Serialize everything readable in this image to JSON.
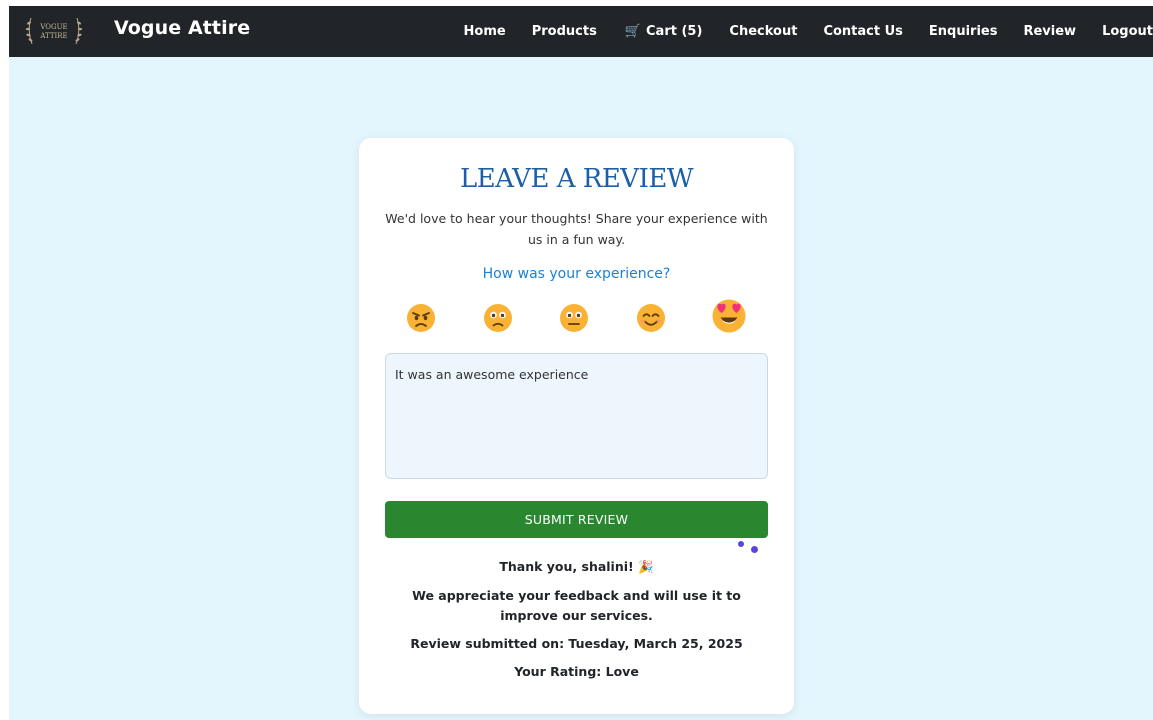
{
  "brand": {
    "logo_text_top": "VOGUE",
    "logo_text_bottom": "ATTIRE",
    "name": "Vogue Attire"
  },
  "nav": {
    "home": "Home",
    "products": "Products",
    "cart": "Cart (5)",
    "checkout": "Checkout",
    "contact": "Contact Us",
    "enquiries": "Enquiries",
    "review": "Review",
    "logout": "Logout"
  },
  "review": {
    "title": "LEAVE A REVIEW",
    "subtitle": "We'd love to hear your thoughts! Share your experience with us in a fun way.",
    "question": "How was your experience?",
    "emojis": [
      "angry-face",
      "sad-face",
      "neutral-face",
      "happy-face",
      "love-face"
    ],
    "selected_emoji": "love-face",
    "comment": "It was an awesome experience",
    "submit_label": "SUBMIT REVIEW",
    "thanks": "Thank you, shalini! 🎉",
    "appreciate": "We appreciate your feedback and will use it to improve our services.",
    "submitted_on": "Review submitted on: Tuesday, March 25, 2025",
    "rating": "Your Rating: Love"
  },
  "colors": {
    "navbar": "#212529",
    "page_bg": "#e3f5fd",
    "title": "#1b5fa8",
    "question": "#1a82d6",
    "submit": "#2b8630",
    "emoji_face": "#f9b233"
  }
}
